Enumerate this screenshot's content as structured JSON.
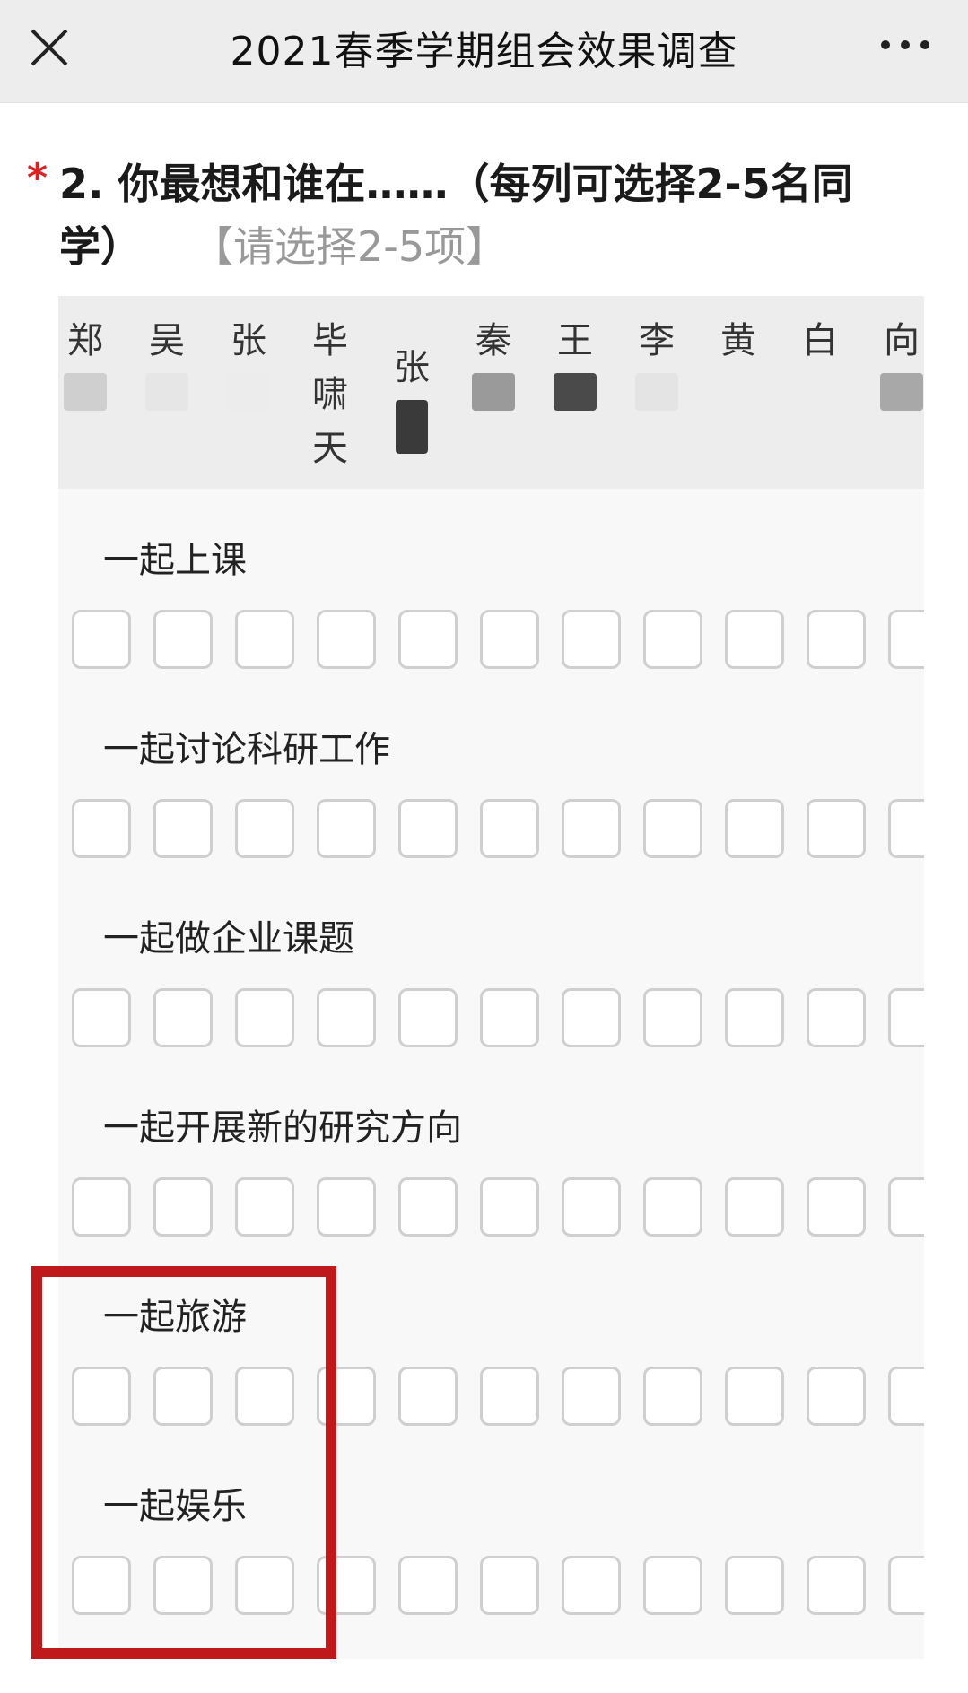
{
  "header": {
    "title": "2021春季学期组会效果调查",
    "close_icon": "close-icon",
    "more_icon": "more-icon"
  },
  "question": {
    "required_mark": "*",
    "text": "2. 你最想和谁在……（每列可选择2-5名同学）",
    "hint": "【请选择2-5项】"
  },
  "columns": [
    "郑",
    "吴",
    "张",
    "毕啸天",
    "张",
    "秦",
    "王",
    "李",
    "黄",
    "白",
    "向"
  ],
  "rows": [
    {
      "label": "一起上课"
    },
    {
      "label": "一起讨论科研工作"
    },
    {
      "label": "一起做企业课题"
    },
    {
      "label": "一起开展新的研究方向"
    },
    {
      "label": "一起旅游"
    },
    {
      "label": "一起娱乐"
    }
  ],
  "colors": {
    "required": "#e02020",
    "highlight_box": "#c0191b",
    "checkbox_border": "#cfcfcf"
  }
}
